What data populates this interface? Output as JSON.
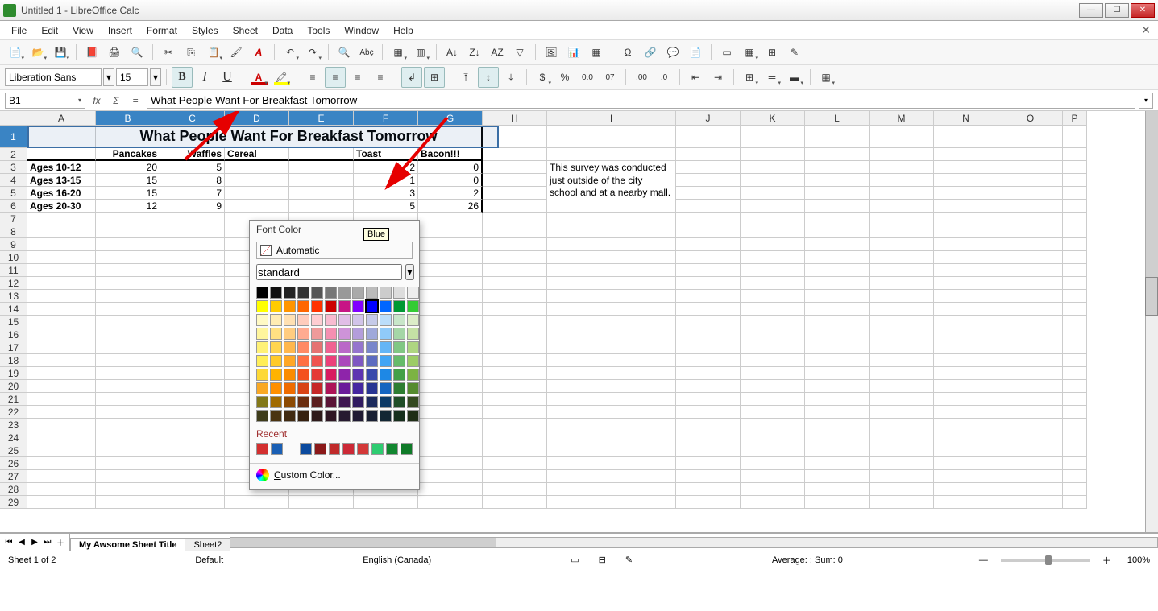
{
  "window": {
    "title": "Untitled 1 - LibreOffice Calc"
  },
  "menu": [
    "File",
    "Edit",
    "View",
    "Insert",
    "Format",
    "Styles",
    "Sheet",
    "Data",
    "Tools",
    "Window",
    "Help"
  ],
  "toolbar2": {
    "font_name": "Liberation Sans",
    "font_size": "15"
  },
  "formula": {
    "cell_ref": "B1",
    "content": "What People Want For Breakfast Tomorrow"
  },
  "columns": [
    "A",
    "B",
    "C",
    "D",
    "E",
    "F",
    "G",
    "H",
    "I",
    "J",
    "K",
    "L",
    "M",
    "N",
    "O",
    "P"
  ],
  "rows": 29,
  "data": {
    "title": "What People Want For Breakfast Tomorrow",
    "headers": [
      "",
      "Pancakes",
      "Waffles",
      "Cereal",
      "",
      "Toast",
      "Bacon!!!"
    ],
    "rows": [
      {
        "label": "Ages 10-12",
        "vals": [
          20,
          5,
          null,
          null,
          "2",
          0
        ]
      },
      {
        "label": "Ages 13-15",
        "vals": [
          15,
          8,
          null,
          null,
          "1",
          0
        ]
      },
      {
        "label": "Ages 16-20",
        "vals": [
          15,
          7,
          null,
          null,
          "3",
          2
        ]
      },
      {
        "label": "Ages 20-30",
        "vals": [
          12,
          9,
          null,
          null,
          "5",
          26
        ]
      }
    ],
    "note": "This survey was conducted just outside of the city school and at a nearby mall."
  },
  "color_popup": {
    "title": "Font Color",
    "automatic": "Automatic",
    "set_name": "standard",
    "selected_tooltip": "Blue",
    "recent_label": "Recent",
    "recent": [
      "#d32f2f",
      "#1a5fb4",
      "#f4f4f4",
      "#0b4a9e",
      "#8b1919",
      "#c02a2a",
      "#cc2936",
      "#d33838",
      "#2ecc71",
      "#11862f",
      "#0f7a28"
    ],
    "custom": "Custom Color..."
  },
  "sheets": {
    "active": "My Awsome Sheet Title",
    "tabs": [
      "My Awsome Sheet Title",
      "Sheet2"
    ]
  },
  "status": {
    "sheet": "Sheet 1 of 2",
    "style": "Default",
    "lang": "English (Canada)",
    "agg": "Average: ; Sum: 0",
    "zoom": "100%"
  },
  "palette_rows": [
    [
      "#000000",
      "#111111",
      "#222222",
      "#333333",
      "#555555",
      "#777777",
      "#999999",
      "#aaaaaa",
      "#bbbbbb",
      "#cccccc",
      "#dddddd",
      "#eeeeee"
    ],
    [
      "#ffff00",
      "#ffcc00",
      "#ff9500",
      "#ff6600",
      "#ff3300",
      "#cc0000",
      "#c71585",
      "#8000ff",
      "#0000ff",
      "#0066ff",
      "#009933",
      "#33cc33"
    ],
    [
      "#fff9c4",
      "#ffecb3",
      "#ffe0b2",
      "#ffccbc",
      "#ffcdd2",
      "#f8bbd0",
      "#e1bee7",
      "#d1c4e9",
      "#c5cae9",
      "#bbdefb",
      "#c8e6c9",
      "#dcedc8"
    ],
    [
      "#fff59d",
      "#ffe082",
      "#ffcc80",
      "#ffab91",
      "#ef9a9a",
      "#f48fb1",
      "#ce93d8",
      "#b39ddb",
      "#9fa8da",
      "#90caf9",
      "#a5d6a7",
      "#c5e1a5"
    ],
    [
      "#fff176",
      "#ffd54f",
      "#ffb74d",
      "#ff8a65",
      "#e57373",
      "#f06292",
      "#ba68c8",
      "#9575cd",
      "#7986cb",
      "#64b5f6",
      "#81c784",
      "#aed581"
    ],
    [
      "#ffee58",
      "#ffca28",
      "#ffa726",
      "#ff7043",
      "#ef5350",
      "#ec407a",
      "#ab47bc",
      "#7e57c2",
      "#5c6bc0",
      "#42a5f5",
      "#66bb6a",
      "#9ccc65"
    ],
    [
      "#fdd835",
      "#ffb300",
      "#fb8c00",
      "#f4511e",
      "#e53935",
      "#d81b60",
      "#8e24aa",
      "#5e35b1",
      "#3949ab",
      "#1e88e5",
      "#43a047",
      "#7cb342"
    ],
    [
      "#f9a825",
      "#ff8f00",
      "#ef6c00",
      "#d84315",
      "#c62828",
      "#ad1457",
      "#6a1b9a",
      "#4527a0",
      "#283593",
      "#1565c0",
      "#2e7d32",
      "#558b2f"
    ],
    [
      "#827717",
      "#a06a00",
      "#8c4a03",
      "#6b2d0f",
      "#5c1f1f",
      "#5a1436",
      "#3f1651",
      "#301b60",
      "#1b2a5c",
      "#0d3a66",
      "#1f4d27",
      "#33491f"
    ],
    [
      "#3e3c1a",
      "#4a3310",
      "#402a12",
      "#35200f",
      "#2e1a1a",
      "#2e1623",
      "#261a30",
      "#1f1a33",
      "#181f33",
      "#122633",
      "#162e1c",
      "#1f2e16"
    ]
  ]
}
